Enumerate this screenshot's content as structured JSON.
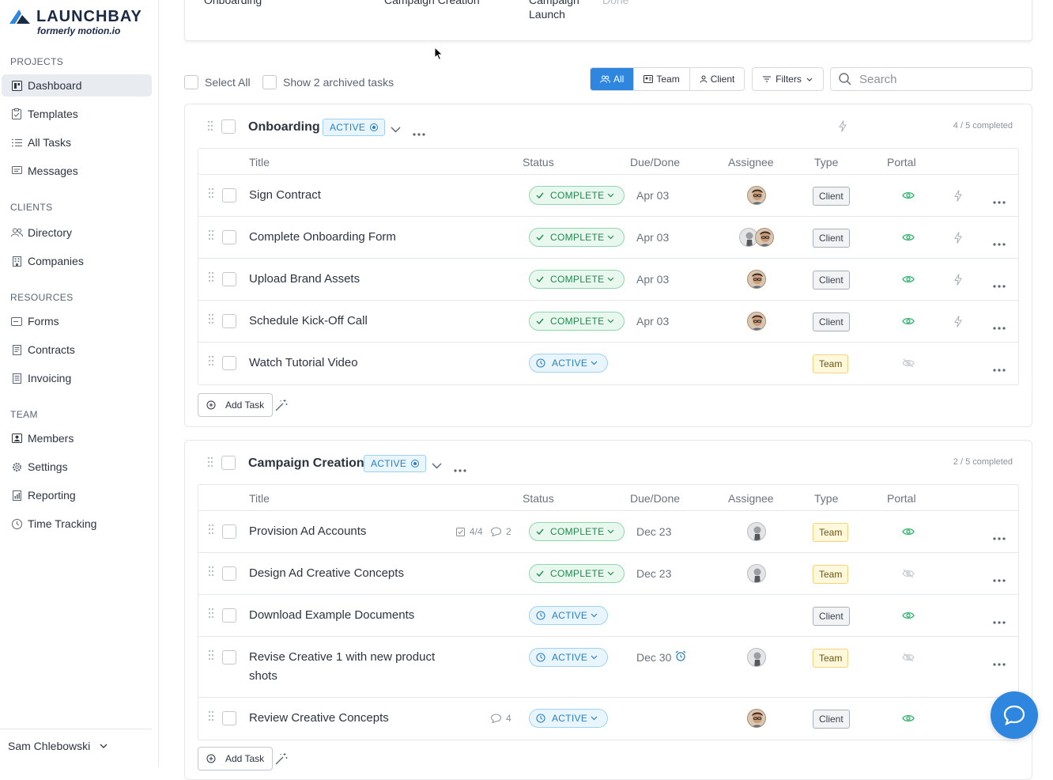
{
  "brand": {
    "name": "LAUNCHBAY",
    "subtitle": "formerly motion.io",
    "color": "#2e86de"
  },
  "sidebar": {
    "sections": [
      {
        "title": "PROJECTS",
        "items": [
          {
            "label": "Dashboard",
            "icon": "dashboard-icon",
            "active": true
          },
          {
            "label": "Templates",
            "icon": "clipboard-icon"
          },
          {
            "label": "All Tasks",
            "icon": "list-icon"
          },
          {
            "label": "Messages",
            "icon": "messages-icon"
          }
        ]
      },
      {
        "title": "CLIENTS",
        "items": [
          {
            "label": "Directory",
            "icon": "people-icon"
          },
          {
            "label": "Companies",
            "icon": "building-icon"
          }
        ]
      },
      {
        "title": "RESOURCES",
        "items": [
          {
            "label": "Forms",
            "icon": "form-icon"
          },
          {
            "label": "Contracts",
            "icon": "contract-icon"
          },
          {
            "label": "Invoicing",
            "icon": "invoice-icon"
          }
        ]
      },
      {
        "title": "TEAM",
        "items": [
          {
            "label": "Members",
            "icon": "members-icon"
          },
          {
            "label": "Settings",
            "icon": "gear-icon"
          },
          {
            "label": "Reporting",
            "icon": "report-icon"
          },
          {
            "label": "Time Tracking",
            "icon": "clock-icon"
          }
        ]
      }
    ],
    "user": "Sam Chlebowski"
  },
  "stages": [
    {
      "label": "Onboarding"
    },
    {
      "label": "Campaign Creation"
    },
    {
      "label": "Campaign Launch"
    },
    {
      "label": "Done"
    }
  ],
  "toolbar": {
    "select_all": "Select All",
    "show_archived": "Show 2 archived tasks",
    "view_all": "All",
    "view_team": "Team",
    "view_client": "Client",
    "filters": "Filters",
    "search_placeholder": "Search"
  },
  "columns": {
    "title": "Title",
    "status": "Status",
    "due": "Due/Done",
    "assignee": "Assignee",
    "type": "Type",
    "portal": "Portal"
  },
  "projects": [
    {
      "title": "Onboarding",
      "status": "ACTIVE",
      "completed": "4 / 5 completed",
      "add_task": "Add Task",
      "tasks": [
        {
          "title": "Sign Contract",
          "status": "COMPLETE",
          "due": "Apr 03",
          "type": "Client",
          "portal_visible": true
        },
        {
          "title": "Complete Onboarding Form",
          "status": "COMPLETE",
          "due": "Apr 03",
          "type": "Client",
          "portal_visible": true
        },
        {
          "title": "Upload Brand Assets",
          "status": "COMPLETE",
          "due": "Apr 03",
          "type": "Client",
          "portal_visible": true
        },
        {
          "title": "Schedule Kick-Off Call",
          "status": "COMPLETE",
          "due": "Apr 03",
          "type": "Client",
          "portal_visible": true
        },
        {
          "title": "Watch Tutorial Video",
          "status": "ACTIVE",
          "due": "",
          "type": "Team",
          "portal_visible": false
        }
      ]
    },
    {
      "title": "Campaign Creation",
      "status": "ACTIVE",
      "completed": "2 / 5 completed",
      "add_task": "Add Task",
      "tasks": [
        {
          "title": "Provision Ad Accounts",
          "checklist": "4/4",
          "comments": "2",
          "status": "COMPLETE",
          "due": "Dec 23",
          "type": "Team",
          "portal_visible": true
        },
        {
          "title": "Design Ad Creative Concepts",
          "status": "COMPLETE",
          "due": "Dec 23",
          "type": "Team",
          "portal_visible": false
        },
        {
          "title": "Download Example Documents",
          "status": "ACTIVE",
          "due": "",
          "type": "Client",
          "portal_visible": true
        },
        {
          "title": "Revise Creative 1 with new product shots",
          "status": "ACTIVE",
          "due": "Dec 30",
          "type": "Team",
          "portal_visible": false
        },
        {
          "title": "Review Creative Concepts",
          "comments": "4",
          "status": "ACTIVE",
          "due": "",
          "type": "Client",
          "portal_visible": true
        }
      ]
    }
  ]
}
